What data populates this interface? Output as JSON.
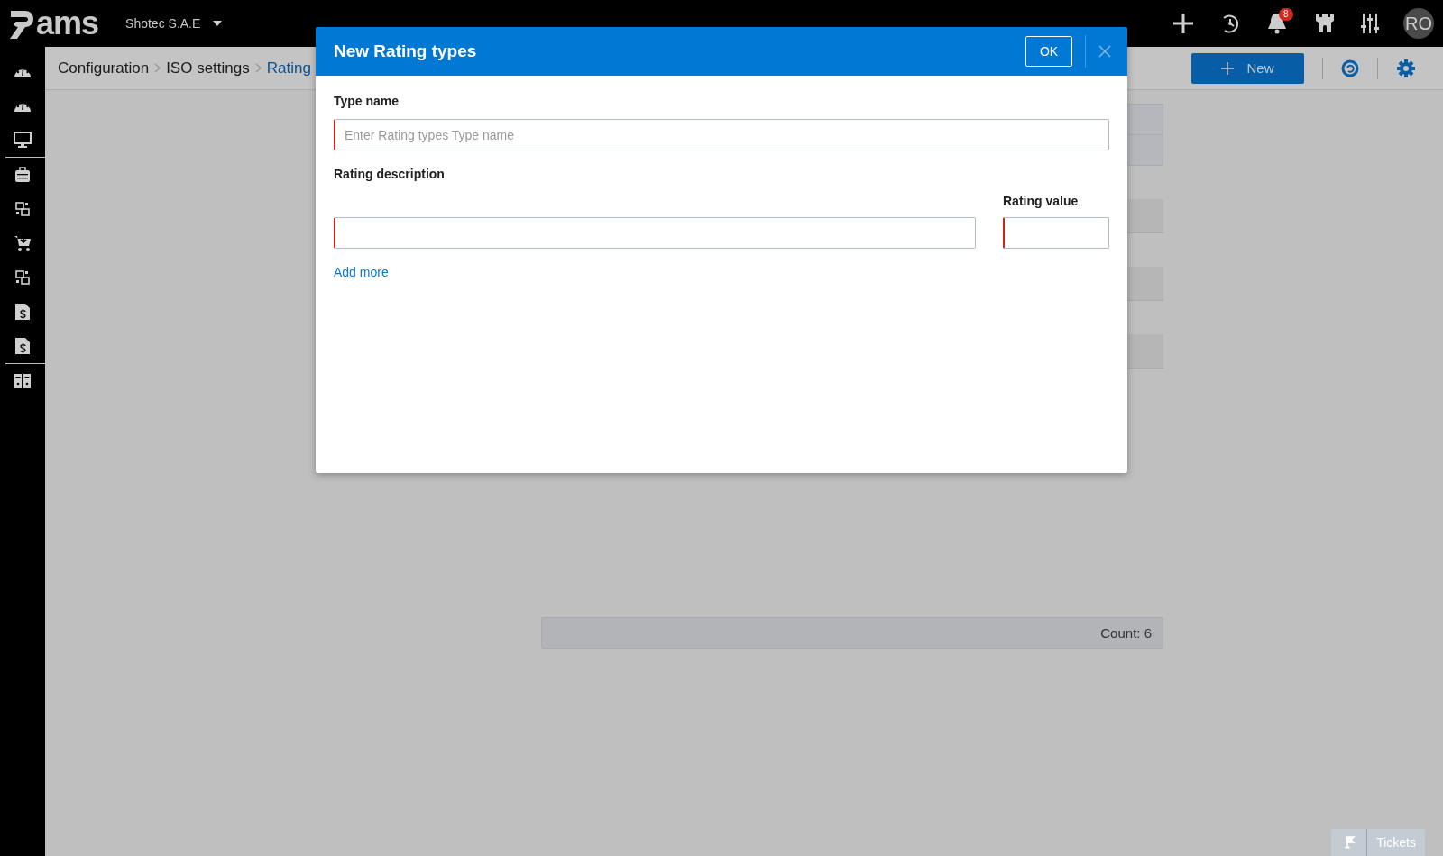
{
  "topbar": {
    "logo": "ams",
    "company": "Shotec S.A.E",
    "notification_count": "8",
    "avatar": "RO"
  },
  "breadcrumb": [
    {
      "label": "Configuration",
      "current": false
    },
    {
      "label": "ISO settings",
      "current": false
    },
    {
      "label": "Rating",
      "current": true
    }
  ],
  "toolbar": {
    "new_button": "New"
  },
  "table": {
    "footer": "Count: 6"
  },
  "modal": {
    "title": "New Rating types",
    "ok": "OK",
    "type_name": {
      "label": "Type name",
      "placeholder": "Enter Rating types Type name",
      "required": true
    },
    "description": {
      "label": "Rating description",
      "required": true
    },
    "value": {
      "label": "Rating value",
      "required": true
    },
    "add_more": "Add more"
  },
  "tickets": {
    "label": "Tickets"
  }
}
